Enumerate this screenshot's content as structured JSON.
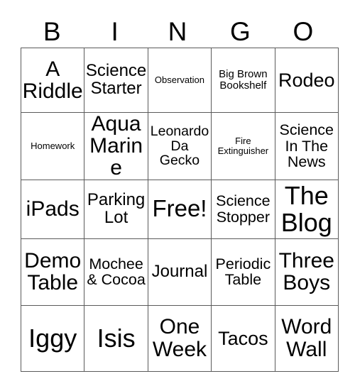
{
  "card": {
    "title": "BINGO Card",
    "header_letters": [
      "B",
      "I",
      "N",
      "G",
      "O"
    ],
    "columns": 5,
    "rows": 5,
    "free_space_label": "Free!",
    "colors": {
      "background": "#ffffff",
      "text": "#000000",
      "grid_line": "#5b5b5b"
    },
    "cells": [
      [
        {
          "text": "A Riddle",
          "size": "fs-30"
        },
        {
          "text": "Science Starter",
          "size": "fs-24"
        },
        {
          "text": "Observation",
          "size": "fs-13"
        },
        {
          "text": "Big Brown Bookshelf",
          "size": "fs-15"
        },
        {
          "text": "Rodeo",
          "size": "fs-27"
        }
      ],
      [
        {
          "text": "Homework",
          "size": "fs-13"
        },
        {
          "text": "Aqua Marine",
          "size": "fs-30"
        },
        {
          "text": "Leonardo Da Gecko",
          "size": "fs-19"
        },
        {
          "text": "Fire Extinguisher",
          "size": "fs-13"
        },
        {
          "text": "Science In The News",
          "size": "fs-21"
        }
      ],
      [
        {
          "text": "iPads",
          "size": "fs-30"
        },
        {
          "text": "Parking Lot",
          "size": "fs-24"
        },
        {
          "text": "Free!",
          "size": "fs-33"
        },
        {
          "text": "Science Stopper",
          "size": "fs-21"
        },
        {
          "text": "The Blog",
          "size": "fs-36"
        }
      ],
      [
        {
          "text": "Demo Table",
          "size": "fs-30"
        },
        {
          "text": "Mochee & Cocoa",
          "size": "fs-21"
        },
        {
          "text": "Journal",
          "size": "fs-24"
        },
        {
          "text": "Periodic Table",
          "size": "fs-21"
        },
        {
          "text": "Three Boys",
          "size": "fs-30"
        }
      ],
      [
        {
          "text": "Iggy",
          "size": "fs-36"
        },
        {
          "text": "Isis",
          "size": "fs-36"
        },
        {
          "text": "One Week",
          "size": "fs-30"
        },
        {
          "text": "Tacos",
          "size": "fs-27"
        },
        {
          "text": "Word Wall",
          "size": "fs-30"
        }
      ]
    ]
  }
}
